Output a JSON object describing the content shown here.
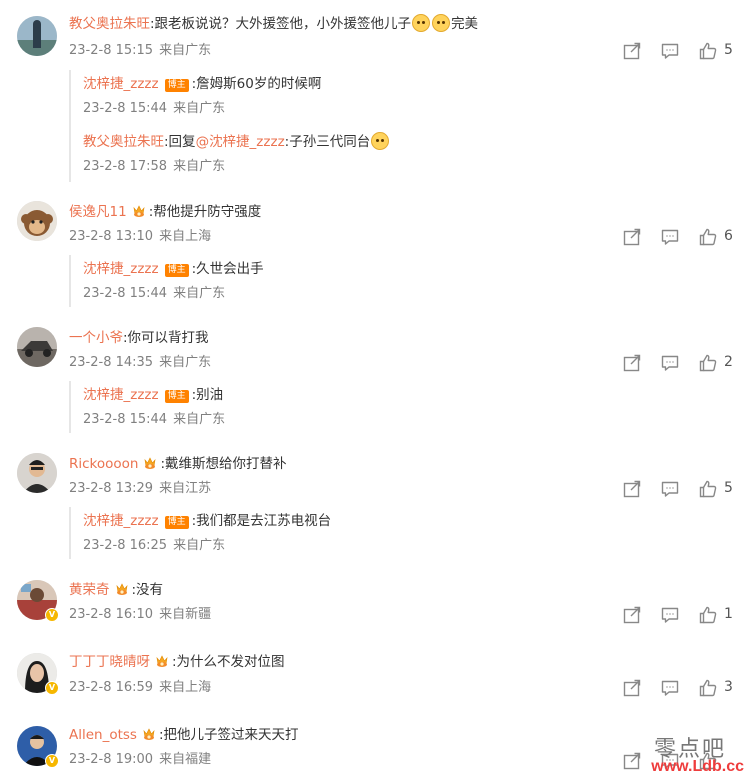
{
  "comments": [
    {
      "username": "教父奥拉朱旺",
      "text_prefix": ":跟老板说说？大外援签他，小外援签他儿子",
      "text_suffix": "完美",
      "date": "23-2-8 15:15",
      "source": "来自广东",
      "likes": "5",
      "replies": [
        {
          "username": "沈梓捷_zzzz",
          "badge": "博主",
          "text": ":詹姆斯60岁的时候啊",
          "date": "23-2-8 15:44",
          "source": "来自广东"
        },
        {
          "username": "教父奥拉朱旺",
          "reply_word": ":回复",
          "mention": "@沈梓捷_zzzz",
          "text": ":子孙三代同台",
          "date": "23-2-8 17:58",
          "source": "来自广东"
        }
      ]
    },
    {
      "username": "侯逸凡11",
      "text": ":帮他提升防守强度",
      "date": "23-2-8 13:10",
      "source": "来自上海",
      "likes": "6",
      "replies": [
        {
          "username": "沈梓捷_zzzz",
          "badge": "博主",
          "text": ":久世会出手",
          "date": "23-2-8 15:44",
          "source": "来自广东"
        }
      ]
    },
    {
      "username": "一个小爷",
      "text": ":你可以背打我",
      "date": "23-2-8 14:35",
      "source": "来自广东",
      "likes": "2",
      "replies": [
        {
          "username": "沈梓捷_zzzz",
          "badge": "博主",
          "text": ":别油",
          "date": "23-2-8 15:44",
          "source": "来自广东"
        }
      ]
    },
    {
      "username": "Rickoooon",
      "text": ":戴维斯想给你打替补",
      "date": "23-2-8 13:29",
      "source": "来自江苏",
      "likes": "5",
      "replies": [
        {
          "username": "沈梓捷_zzzz",
          "badge": "博主",
          "text": ":我们都是去江苏电视台",
          "date": "23-2-8 16:25",
          "source": "来自广东"
        }
      ]
    },
    {
      "username": "黄荣奇",
      "text": ":没有",
      "date": "23-2-8 16:10",
      "source": "来自新疆",
      "likes": "1"
    },
    {
      "username": "丁丁丁晓晴呀",
      "text": ":为什么不发对位图",
      "date": "23-2-8 16:59",
      "source": "来自上海",
      "likes": "3"
    },
    {
      "username": "Allen_otss",
      "text": ":把他儿子签过来天天打",
      "date": "23-2-8 19:00",
      "source": "来自福建"
    }
  ],
  "watermark": {
    "title": "零点吧",
    "url": "www.Ldb.cc"
  },
  "icons": {
    "share": "share-icon",
    "comment": "comment-icon",
    "like": "thumbs-up-icon",
    "medal": "fan-medal-icon",
    "verified": "verified-badge-icon"
  },
  "colors": {
    "username": "#eb7350",
    "meta": "#808080",
    "blogger_badge": "#ff8200"
  }
}
